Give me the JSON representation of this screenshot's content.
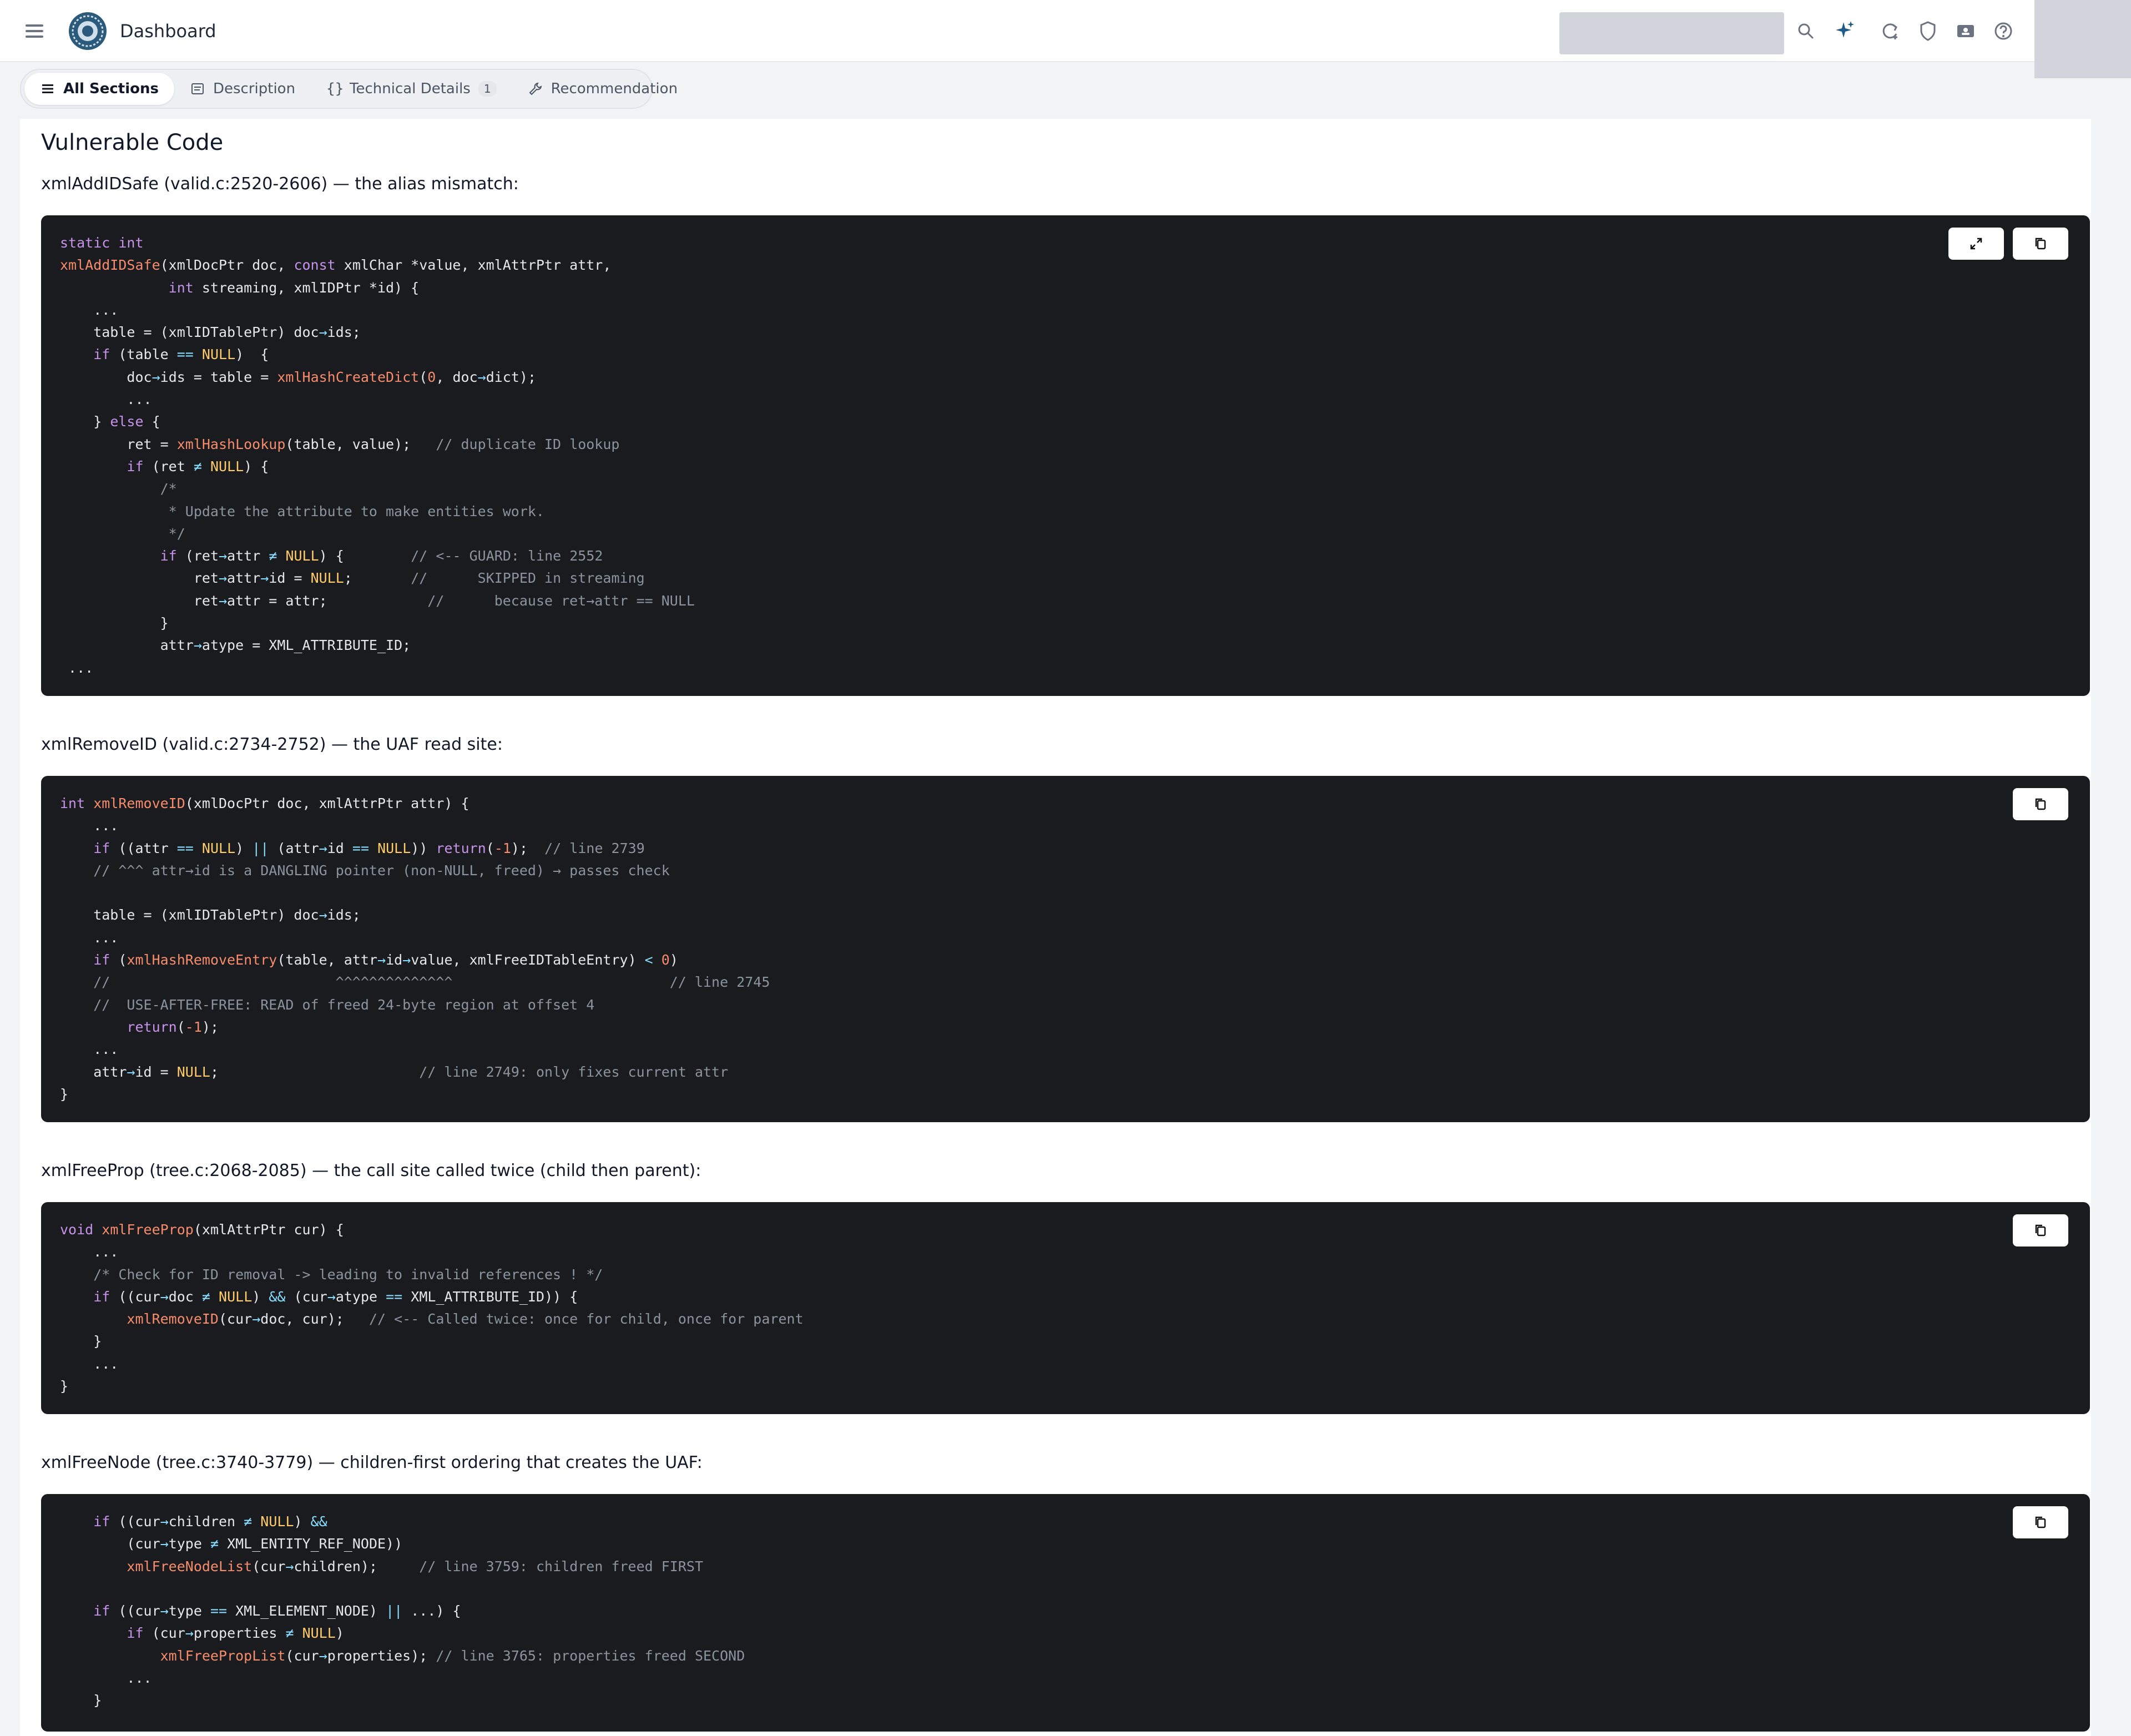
{
  "header": {
    "title": "Dashboard",
    "icons": [
      "menu-icon",
      "logo",
      "search-icon",
      "sparkle-icon",
      "refresh-icon",
      "shield-icon",
      "ticket-icon",
      "help-icon"
    ]
  },
  "tabs": [
    {
      "label": "All Sections",
      "icon": "list-icon",
      "active": true
    },
    {
      "label": "Description",
      "icon": "document-icon"
    },
    {
      "label": "Technical Details",
      "icon": "braces-icon",
      "badge": "1"
    },
    {
      "label": "Recommendation",
      "icon": "wrench-icon"
    }
  ],
  "content": {
    "title": "Vulnerable Code",
    "blocks": [
      {
        "caption": "xmlAddIDSafe (valid.c:2520-2606) — the alias mismatch:",
        "has_expand": true,
        "lines": [
          "static int",
          "xmlAddIDSafe(xmlDocPtr doc, const xmlChar *value, xmlAttrPtr attr,",
          "             int streaming, xmlIDPtr *id) {",
          "    ...",
          "    table = (xmlIDTablePtr) doc->ids;",
          "    if (table == NULL)  {",
          "        doc->ids = table = xmlHashCreateDict(0, doc->dict);",
          "        ...",
          "    } else {",
          "        ret = xmlHashLookup(table, value);   // duplicate ID lookup",
          "        if (ret != NULL) {",
          "            /*",
          "             * Update the attribute to make entities work.",
          "             */",
          "            if (ret->attr != NULL) {        // <-- GUARD: line 2552",
          "                ret->attr->id = NULL;       //      SKIPPED in streaming",
          "                ret->attr = attr;            //      because ret->attr == NULL",
          "            }",
          "            attr->atype = XML_ATTRIBUTE_ID;",
          " ..."
        ]
      },
      {
        "caption": "xmlRemoveID (valid.c:2734-2752) — the UAF read site:",
        "has_expand": false,
        "lines": [
          "int xmlRemoveID(xmlDocPtr doc, xmlAttrPtr attr) {",
          "    ...",
          "    if ((attr == NULL) || (attr->id == NULL)) return(-1);  // line 2739",
          "    // ^^^ attr->id is a DANGLING pointer (non-NULL, freed) → passes check",
          "",
          "    table = (xmlIDTablePtr) doc->ids;",
          "    ...",
          "    if (xmlHashRemoveEntry(table, attr->id->value, xmlFreeIDTableEntry) < 0)",
          "    //                           ^^^^^^^^^^^^^^                          // line 2745",
          "    //  USE-AFTER-FREE: READ of freed 24-byte region at offset 4",
          "        return(-1);",
          "    ...",
          "    attr->id = NULL;                        // line 2749: only fixes current attr",
          "}"
        ]
      },
      {
        "caption": "xmlFreeProp (tree.c:2068-2085) — the call site called twice (child then parent):",
        "has_expand": false,
        "lines": [
          "void xmlFreeProp(xmlAttrPtr cur) {",
          "    ...",
          "    /* Check for ID removal -> leading to invalid references ! */",
          "    if ((cur->doc != NULL) && (cur->atype == XML_ATTRIBUTE_ID)) {",
          "        xmlRemoveID(cur->doc, cur);   // <-- Called twice: once for child, once for parent",
          "    }",
          "    ...",
          "}"
        ]
      },
      {
        "caption": "xmlFreeNode (tree.c:3740-3779) — children-first ordering that creates the UAF:",
        "has_expand": false,
        "lines": [
          "    if ((cur->children != NULL) &&",
          "        (cur->type != XML_ENTITY_REF_NODE))",
          "        xmlFreeNodeList(cur->children);     // line 3759: children freed FIRST",
          "",
          "    if ((cur->type == XML_ELEMENT_NODE) || ...) {",
          "        if (cur->properties != NULL)",
          "            xmlFreePropList(cur->properties); // line 3765: properties freed SECOND",
          "        ...",
          "    }"
        ]
      }
    ]
  }
}
